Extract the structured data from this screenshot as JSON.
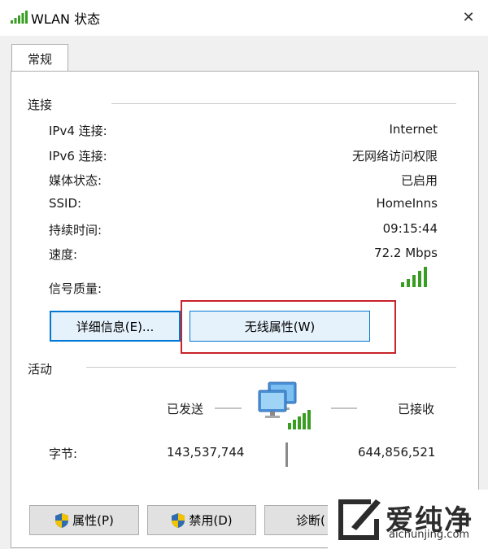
{
  "window": {
    "title": "WLAN 状态",
    "close_glyph": "✕"
  },
  "tabs": [
    {
      "label": "常规",
      "selected": true
    }
  ],
  "connection": {
    "group_label": "连接",
    "rows": [
      {
        "label": "IPv4 连接:",
        "value": "Internet"
      },
      {
        "label": "IPv6 连接:",
        "value": "无网络访问权限"
      },
      {
        "label": "媒体状态:",
        "value": "已启用"
      },
      {
        "label": "SSID:",
        "value": "HomeInns"
      },
      {
        "label": "持续时间:",
        "value": "09:15:44"
      },
      {
        "label": "速度:",
        "value": "72.2 Mbps"
      }
    ],
    "signal_label": "信号质量:",
    "signal_bars": 5,
    "details_button": "详细信息(E)...",
    "wireless_props_button": "无线属性(W)"
  },
  "activity": {
    "group_label": "活动",
    "sent_label": "已发送",
    "received_label": "已接收",
    "bytes_label": "字节:",
    "bytes_sent": "143,537,744",
    "bytes_received": "644,856,521"
  },
  "footer_buttons": {
    "properties": "属性(P)",
    "disable": "禁用(D)",
    "diagnose": "诊断("
  },
  "watermark": {
    "brand": "爱纯净",
    "url": "aichunjing.com"
  },
  "colors": {
    "signal_green": "#3a9d23",
    "highlight_red": "#c8222a",
    "focus_blue": "#0078d7",
    "dialog_bg": "#f0f0f0",
    "button_bg": "#e1e1e1"
  }
}
